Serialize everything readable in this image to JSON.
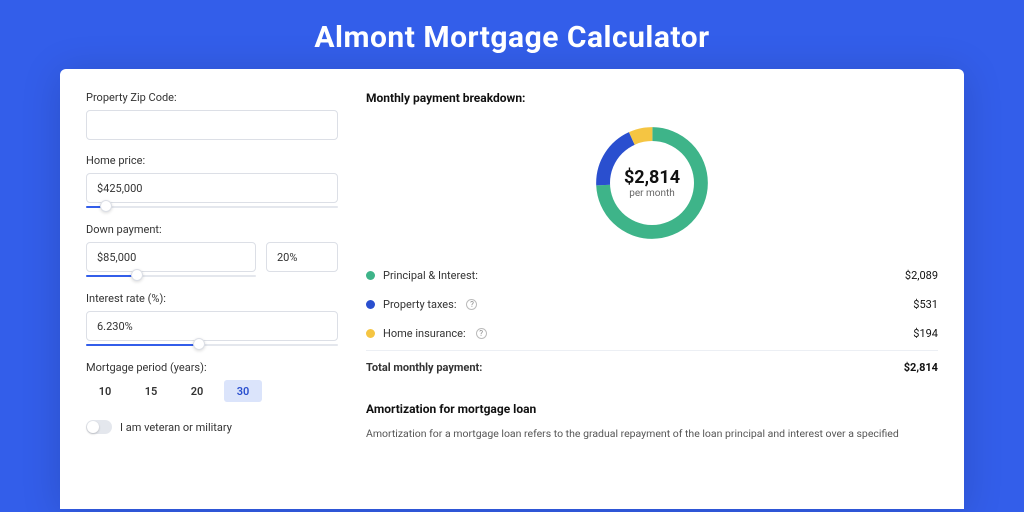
{
  "title": "Almont Mortgage Calculator",
  "colors": {
    "green": "#3eb489",
    "blue": "#2a4fcf",
    "yellow": "#f5c542"
  },
  "inputs": {
    "zip": {
      "label": "Property Zip Code:",
      "value": ""
    },
    "price": {
      "label": "Home price:",
      "value": "$425,000",
      "slider_pct": 8
    },
    "down": {
      "label": "Down payment:",
      "amount": "$85,000",
      "amount_slider_pct": 30,
      "percent": "20%"
    },
    "rate": {
      "label": "Interest rate (%):",
      "value": "6.230%",
      "slider_pct": 45
    },
    "period": {
      "label": "Mortgage period (years):",
      "options": [
        "10",
        "15",
        "20",
        "30"
      ],
      "active": "30"
    },
    "veteran": {
      "label": "I am veteran or military",
      "checked": false
    }
  },
  "breakdown": {
    "title": "Monthly payment breakdown:",
    "center_amount": "$2,814",
    "center_sub": "per month",
    "rows": [
      {
        "key": "pi",
        "label": "Principal & Interest:",
        "value": "$2,089",
        "num": 2089,
        "color": "#3eb489",
        "info": false
      },
      {
        "key": "tax",
        "label": "Property taxes:",
        "value": "$531",
        "num": 531,
        "color": "#2a4fcf",
        "info": true
      },
      {
        "key": "ins",
        "label": "Home insurance:",
        "value": "$194",
        "num": 194,
        "color": "#f5c542",
        "info": true
      }
    ],
    "total": {
      "label": "Total monthly payment:",
      "value": "$2,814",
      "num": 2814
    }
  },
  "chart_data": {
    "type": "pie",
    "title": "Monthly payment breakdown",
    "series": [
      {
        "name": "Principal & Interest",
        "value": 2089,
        "color": "#3eb489"
      },
      {
        "name": "Property taxes",
        "value": 531,
        "color": "#2a4fcf"
      },
      {
        "name": "Home insurance",
        "value": 194,
        "color": "#f5c542"
      }
    ],
    "center_label": "$2,814 per month"
  },
  "amortization": {
    "title": "Amortization for mortgage loan",
    "text": "Amortization for a mortgage loan refers to the gradual repayment of the loan principal and interest over a specified"
  }
}
